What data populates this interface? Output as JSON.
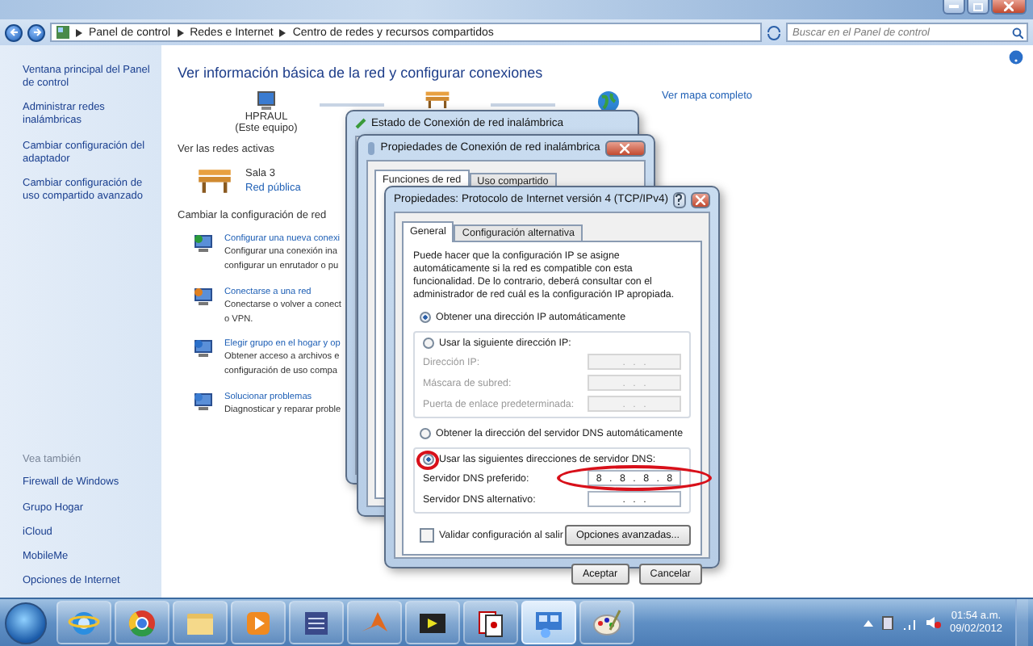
{
  "window": {
    "breadcrumb": [
      "Panel de control",
      "Redes e Internet",
      "Centro de redes y recursos compartidos"
    ],
    "search": {
      "placeholder": "Buscar en el Panel de control"
    }
  },
  "sidebar": {
    "links": [
      "Ventana principal del Panel de control",
      "Administrar redes inalámbricas",
      "Cambiar configuración del adaptador",
      "Cambiar configuración de uso compartido avanzado"
    ],
    "see_also_heading": "Vea también",
    "see_also": [
      "Firewall de Windows",
      "Grupo Hogar",
      "iCloud",
      "MobileMe",
      "Opciones de Internet"
    ]
  },
  "main": {
    "heading": "Ver información básica de la red y configurar conexiones",
    "map": {
      "computer_name": "HPRAUL",
      "computer_note": "(Este equipo)",
      "full_map_link": "Ver mapa completo"
    },
    "active_networks_heading": "Ver las redes activas",
    "active_network": {
      "name": "Sala 3",
      "type": "Red pública"
    },
    "change_heading": "Cambiar la configuración de red",
    "tasks": [
      {
        "kind": "new",
        "title": "Configurar una nueva conexi",
        "lines": [
          "Configurar una conexión ina",
          "configurar un enrutador o pu"
        ]
      },
      {
        "kind": "connect",
        "title": "Conectarse a una red",
        "lines": [
          "Conectarse o volver a conect",
          "o VPN."
        ]
      },
      {
        "kind": "homegroup",
        "title": "Elegir grupo en el hogar y op",
        "lines": [
          "Obtener acceso a archivos e",
          "configuración de uso compa"
        ]
      },
      {
        "kind": "troubleshoot",
        "title": "Solucionar problemas",
        "lines": [
          "Diagnosticar y reparar proble"
        ]
      }
    ]
  },
  "status_dialog": {
    "title": "Estado de Conexión de red inalámbrica"
  },
  "properties_dialog": {
    "title": "Propiedades de Conexión de red inalámbrica",
    "tabs": [
      {
        "label": "Funciones de red",
        "selected": true
      },
      {
        "label": "Uso compartido",
        "selected": false
      }
    ]
  },
  "ipv4_dialog": {
    "title": "Propiedades: Protocolo de Internet versión 4 (TCP/IPv4)",
    "tabs": [
      {
        "label": "General",
        "selected": true
      },
      {
        "label": "Configuración alternativa",
        "selected": false
      }
    ],
    "intro": "Puede hacer que la configuración IP se asigne automáticamente si la red es compatible con esta funcionalidad. De lo contrario, deberá consultar con el administrador de red cuál es la configuración IP apropiada.",
    "ip_options": [
      {
        "label": "Obtener una dirección IP automáticamente",
        "selected": true,
        "circled": false
      },
      {
        "label": "Usar la siguiente dirección IP:",
        "selected": false,
        "circled": false
      }
    ],
    "ip_fields": [
      {
        "label": "Dirección IP:",
        "value": ". . .",
        "disabled": true,
        "circled": false
      },
      {
        "label": "Máscara de subred:",
        "value": ". . .",
        "disabled": true,
        "circled": false
      },
      {
        "label": "Puerta de enlace predeterminada:",
        "value": ". . .",
        "disabled": true,
        "circled": false
      }
    ],
    "dns_options": [
      {
        "label": "Obtener la dirección del servidor DNS automáticamente",
        "selected": false,
        "circled": false
      },
      {
        "label": "Usar las siguientes direcciones de servidor DNS:",
        "selected": true,
        "circled": true
      }
    ],
    "dns_fields": [
      {
        "label": "Servidor DNS preferido:",
        "value": "8 . 8 . 8 . 8",
        "disabled": false,
        "circled": true
      },
      {
        "label": "Servidor DNS alternativo:",
        "value": ". . .",
        "disabled": false,
        "circled": false
      }
    ],
    "validate": {
      "label": "Validar configuración al salir",
      "checked": false
    },
    "advanced_button": "Opciones avanzadas...",
    "buttons": [
      "Aceptar",
      "Cancelar"
    ]
  },
  "taskbar": {
    "apps": [
      {
        "kind": "ie",
        "active": false
      },
      {
        "kind": "chrome",
        "active": false
      },
      {
        "kind": "folder",
        "active": false
      },
      {
        "kind": "media",
        "active": false
      },
      {
        "kind": "app",
        "active": false
      },
      {
        "kind": "matlab",
        "active": false
      },
      {
        "kind": "film",
        "active": false
      },
      {
        "kind": "cards",
        "active": false
      },
      {
        "kind": "network",
        "active": true
      },
      {
        "kind": "paint",
        "active": false
      }
    ],
    "time": "01:54 a.m.",
    "date": "09/02/2012"
  }
}
